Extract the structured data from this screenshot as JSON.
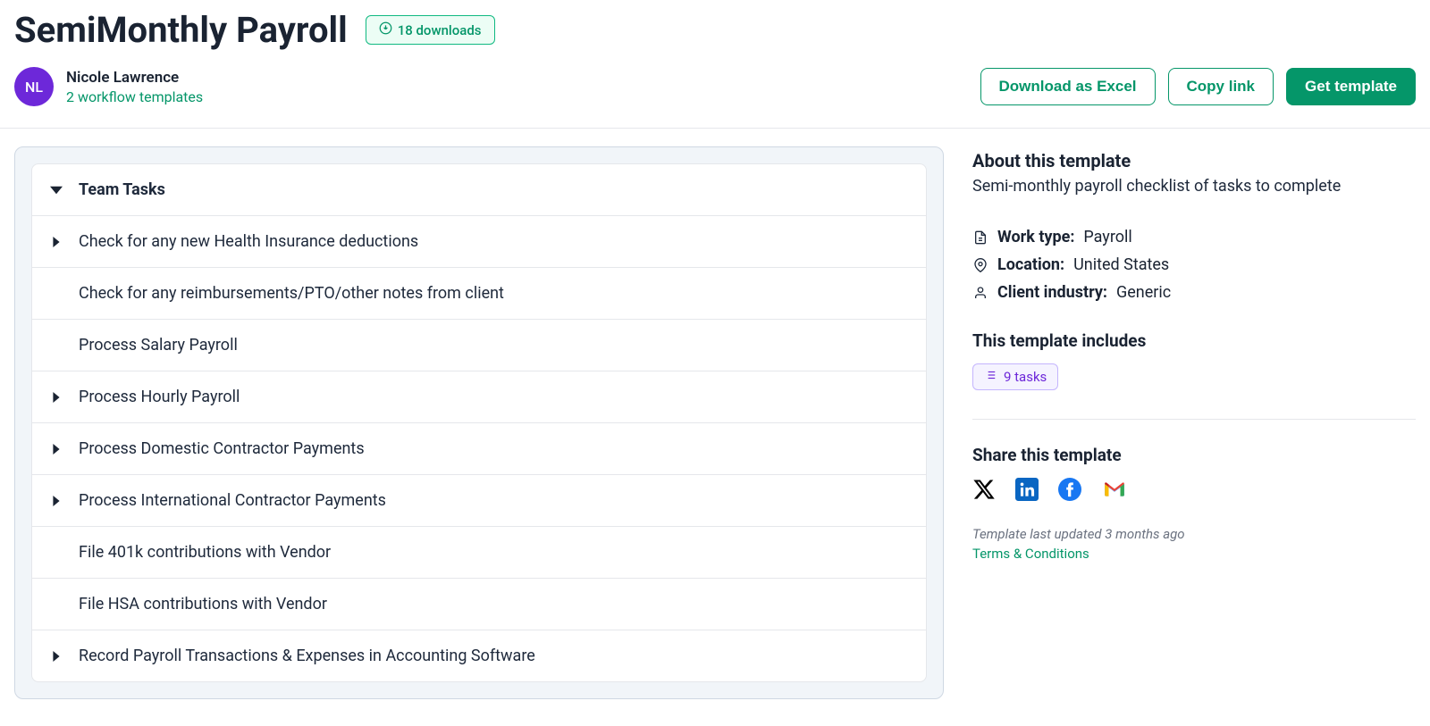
{
  "header": {
    "title": "SemiMonthly Payroll",
    "downloads_badge": "18 downloads"
  },
  "author": {
    "initials": "NL",
    "name": "Nicole Lawrence",
    "sub": "2 workflow templates"
  },
  "actions": {
    "download_excel": "Download as Excel",
    "copy_link": "Copy link",
    "get_template": "Get template"
  },
  "tasks": {
    "section_title": "Team Tasks",
    "items": [
      {
        "title": "Check for any new Health Insurance deductions",
        "expandable": true
      },
      {
        "title": "Check for any reimbursements/PTO/other notes from client",
        "expandable": false
      },
      {
        "title": "Process Salary Payroll",
        "expandable": false
      },
      {
        "title": "Process Hourly Payroll",
        "expandable": true
      },
      {
        "title": "Process Domestic Contractor Payments",
        "expandable": true
      },
      {
        "title": "Process International Contractor Payments",
        "expandable": true
      },
      {
        "title": "File 401k contributions with Vendor",
        "expandable": false
      },
      {
        "title": "File HSA contributions with Vendor",
        "expandable": false
      },
      {
        "title": "Record Payroll Transactions & Expenses in Accounting Software",
        "expandable": true
      }
    ]
  },
  "about": {
    "title": "About this template",
    "description": "Semi-monthly payroll checklist of tasks to complete",
    "work_type_label": "Work type:",
    "work_type_value": "Payroll",
    "location_label": "Location:",
    "location_value": "United States",
    "industry_label": "Client industry:",
    "industry_value": "Generic"
  },
  "includes": {
    "title": "This template includes",
    "tasks_badge": "9 tasks"
  },
  "share": {
    "title": "Share this template"
  },
  "footer": {
    "updated": "Template last updated 3 months ago",
    "terms": "Terms & Conditions"
  }
}
